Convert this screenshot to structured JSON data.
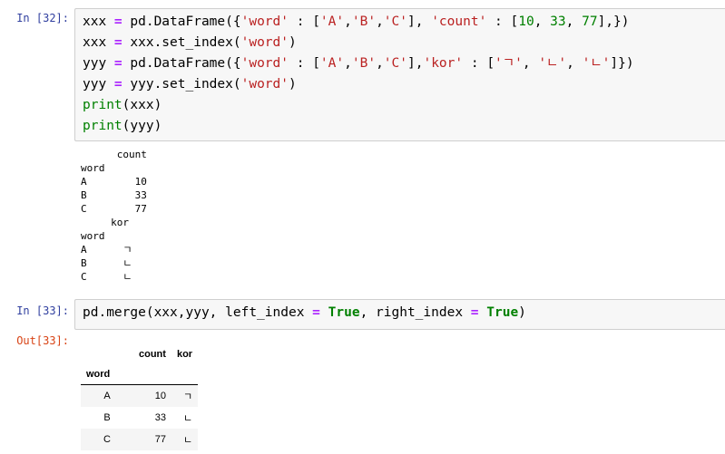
{
  "cells": [
    {
      "prompt": "In [32]:",
      "lines": [
        [
          {
            "t": "xxx "
          },
          {
            "t": "=",
            "c": "op"
          },
          {
            "t": " pd.DataFrame({"
          },
          {
            "t": "'word'",
            "c": "st"
          },
          {
            "t": " : ["
          },
          {
            "t": "'A'",
            "c": "st"
          },
          {
            "t": ","
          },
          {
            "t": "'B'",
            "c": "st"
          },
          {
            "t": ","
          },
          {
            "t": "'C'",
            "c": "st"
          },
          {
            "t": "], "
          },
          {
            "t": "'count'",
            "c": "st"
          },
          {
            "t": " : ["
          },
          {
            "t": "10",
            "c": "nu"
          },
          {
            "t": ", "
          },
          {
            "t": "33",
            "c": "nu"
          },
          {
            "t": ", "
          },
          {
            "t": "77",
            "c": "nu"
          },
          {
            "t": "],})"
          }
        ],
        [
          {
            "t": "xxx "
          },
          {
            "t": "=",
            "c": "op"
          },
          {
            "t": " xxx.set_index("
          },
          {
            "t": "'word'",
            "c": "st"
          },
          {
            "t": ")"
          }
        ],
        [
          {
            "t": "yyy "
          },
          {
            "t": "=",
            "c": "op"
          },
          {
            "t": " pd.DataFrame({"
          },
          {
            "t": "'word'",
            "c": "st"
          },
          {
            "t": " : ["
          },
          {
            "t": "'A'",
            "c": "st"
          },
          {
            "t": ","
          },
          {
            "t": "'B'",
            "c": "st"
          },
          {
            "t": ","
          },
          {
            "t": "'C'",
            "c": "st"
          },
          {
            "t": "],"
          },
          {
            "t": "'kor'",
            "c": "st"
          },
          {
            "t": " : ["
          },
          {
            "t": "'ㄱ'",
            "c": "st"
          },
          {
            "t": ", "
          },
          {
            "t": "'ㄴ'",
            "c": "st"
          },
          {
            "t": ", "
          },
          {
            "t": "'ㄴ'",
            "c": "st"
          },
          {
            "t": "]})"
          }
        ],
        [
          {
            "t": "yyy "
          },
          {
            "t": "=",
            "c": "op"
          },
          {
            "t": " yyy.set_index("
          },
          {
            "t": "'word'",
            "c": "st"
          },
          {
            "t": ")"
          }
        ],
        [
          {
            "t": "print",
            "c": "bi"
          },
          {
            "t": "(xxx)"
          }
        ],
        [
          {
            "t": "print",
            "c": "bi"
          },
          {
            "t": "(yyy)"
          }
        ]
      ]
    },
    {
      "prompt": "In [33]:",
      "lines": [
        [
          {
            "t": "pd.merge(xxx,yyy, left_index "
          },
          {
            "t": "=",
            "c": "op"
          },
          {
            "t": " "
          },
          {
            "t": "True",
            "c": "kw"
          },
          {
            "t": ", right_index "
          },
          {
            "t": "=",
            "c": "op"
          },
          {
            "t": " "
          },
          {
            "t": "True",
            "c": "kw"
          },
          {
            "t": ")"
          }
        ]
      ]
    }
  ],
  "stdout": "      count\nword       \nA        10\nB        33\nC        77\n     kor\nword    \nA      ㄱ\nB      ㄴ\nC      ㄴ",
  "output_prompt": "Out[33]:",
  "result_table": {
    "columns": [
      "count",
      "kor"
    ],
    "index_name": "word",
    "rows": [
      {
        "index": "A",
        "count": "10",
        "kor": "ㄱ"
      },
      {
        "index": "B",
        "count": "33",
        "kor": "ㄴ"
      },
      {
        "index": "C",
        "count": "77",
        "kor": "ㄴ"
      }
    ]
  }
}
